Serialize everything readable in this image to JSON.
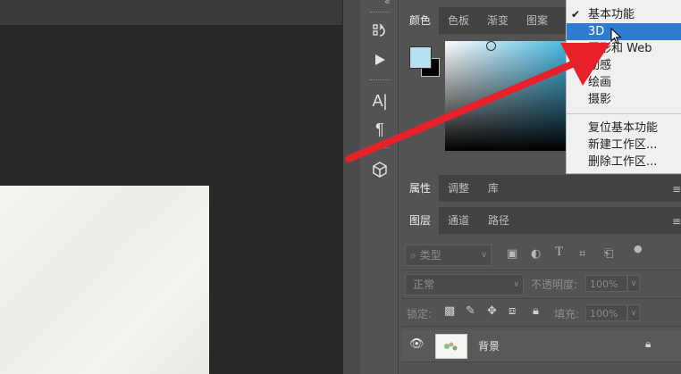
{
  "toolstrip": {
    "collapse_glyph": "«",
    "tools": [
      "history-icon",
      "play-icon",
      "character-icon",
      "paragraph-icon",
      "3d-cube-icon"
    ]
  },
  "color_panel": {
    "tabs": [
      "颜色",
      "色板",
      "渐变",
      "图案"
    ],
    "foreground_color": "#b5e2f3",
    "background_color": "#000000"
  },
  "workspace_menu": {
    "items": [
      "基本功能",
      "3D",
      "图形和 Web",
      "动感",
      "绘画",
      "摄影"
    ],
    "checked_item": "基本功能",
    "highlighted_item": "3D",
    "actions": [
      "复位基本功能",
      "新建工作区...",
      "删除工作区..."
    ]
  },
  "properties_panel": {
    "tabs": [
      "属性",
      "调整",
      "库"
    ],
    "menu_glyph": "≡"
  },
  "layers_panel": {
    "tabs": [
      "图层",
      "通道",
      "路径"
    ],
    "menu_glyph": "≡",
    "filter_placeholder": "类型",
    "blend_mode": "正常",
    "opacity_label": "不透明度:",
    "opacity_value": "100%",
    "lock_label": "锁定:",
    "fill_label": "填充:",
    "fill_value": "100%",
    "layers": [
      {
        "name": "背景",
        "visible": true,
        "locked": true
      }
    ]
  },
  "annotation": {
    "arrow_color": "#e8202a"
  }
}
